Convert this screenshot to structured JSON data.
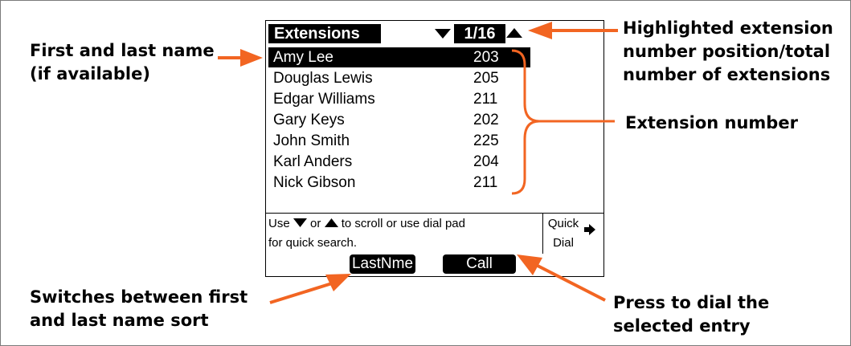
{
  "screen": {
    "title": "Extensions",
    "position": "1/16",
    "entries": [
      {
        "name": "Amy Lee",
        "ext": "203",
        "selected": true
      },
      {
        "name": "Douglas Lewis",
        "ext": "205",
        "selected": false
      },
      {
        "name": "Edgar Williams",
        "ext": "211",
        "selected": false
      },
      {
        "name": "Gary Keys",
        "ext": "202",
        "selected": false
      },
      {
        "name": "John Smith",
        "ext": "225",
        "selected": false
      },
      {
        "name": "Karl Anders",
        "ext": "204",
        "selected": false
      },
      {
        "name": "Nick Gibson",
        "ext": "211",
        "selected": false
      }
    ],
    "help": {
      "use": "Use",
      "or": "or",
      "to_scroll": "to scroll or use dial pad",
      "line2": "for quick search."
    },
    "quick_dial": {
      "line1": "Quick",
      "line2": "Dial"
    },
    "softkeys": {
      "left": "LastNme",
      "right": "Call"
    }
  },
  "callouts": {
    "first_last_name": [
      "First and last name",
      "(if available)"
    ],
    "highlighted_position": [
      "Highlighted extension",
      "number position/total",
      "number of extensions"
    ],
    "extension_number": "Extension number",
    "switches_sort": [
      "Switches between first",
      "and last name sort"
    ],
    "press_to_dial": [
      "Press to dial the",
      "selected entry"
    ]
  },
  "colors": {
    "accent": "#f26522",
    "lcd_border": "#000000",
    "frame_border": "#7a7a7a"
  }
}
